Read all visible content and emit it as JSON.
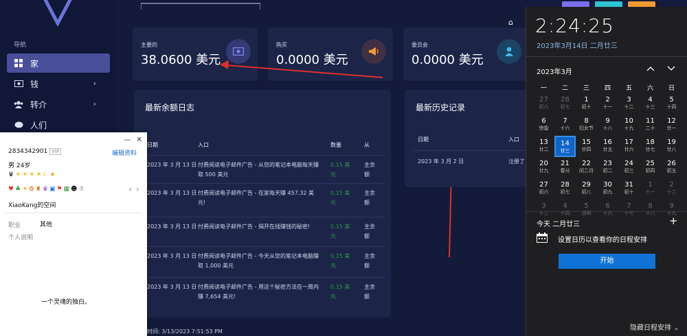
{
  "nav": {
    "title": "导航",
    "items": [
      {
        "label": "家",
        "icon": "grid-icon",
        "active": true
      },
      {
        "label": "钱",
        "icon": "cash-icon"
      },
      {
        "label": "转介",
        "icon": "users-icon"
      },
      {
        "label": "人们",
        "icon": "chat-icon"
      }
    ]
  },
  "stats": [
    {
      "label": "主要的",
      "value": "38.0600 美元",
      "icon": "money-icon",
      "icon_bg": "#343a73",
      "icon_color": "#7f86f2"
    },
    {
      "label": "购买",
      "value": "0.0000 美元",
      "icon": "megaphone-icon",
      "icon_bg": "#3f3044",
      "icon_color": "#f29a33"
    },
    {
      "label": "委员会",
      "value": "0.0000 美元",
      "icon": "user-icon",
      "icon_bg": "#1b4363",
      "icon_color": "#3fb7e8"
    }
  ],
  "balance_log": {
    "title": "最新余额日志",
    "headers": {
      "date": "日期",
      "entry": "入口",
      "amount": "数量",
      "from": "从"
    },
    "rows": [
      {
        "date": "2023 年 3 月 13 日",
        "entry": "付费阅读电子邮件广告 - 从您的笔记本电脑每天赚取 500 美元",
        "amount": "0.15 美元",
        "from": "主余额"
      },
      {
        "date": "2023 年 3 月 13 日",
        "entry": "付费阅读电子邮件广告 - 在家每天赚 457.32 美元!",
        "amount": "0.15 美元",
        "from": "主余额"
      },
      {
        "date": "2023 年 3 月 13 日",
        "entry": "付费阅读电子邮件广告 - 揭开在线赚钱的秘密!",
        "amount": "0.15 美元",
        "from": "主余额"
      },
      {
        "date": "2023 年 3 月 13 日",
        "entry": "付费阅读电子邮件广告 - 今天从您的笔记本电脑赚取 1,000 美元",
        "amount": "0.15 美元",
        "from": "主余额"
      },
      {
        "date": "2023 年 3 月 13 日",
        "entry": "付费阅读电子邮件广告 - 用这个秘密方法在一周内赚 7,654 美元!",
        "amount": "0.15 美元",
        "from": "主余额"
      }
    ]
  },
  "history": {
    "title": "最新历史记录",
    "headers": {
      "date": "日期",
      "entry": "入口"
    },
    "rows": [
      {
        "date": "2023 年 3 月 2 日",
        "entry": "注册了"
      }
    ]
  },
  "footer": {
    "time": "时间: 3/13/2023 7:51:53 PM"
  },
  "profile": {
    "qq": "2834342901",
    "badge": "VIP",
    "edit": "编辑资料",
    "gender_age": "男  24岁",
    "space": "XiaoKang的空间",
    "job_label": "职业",
    "job_value": "其他",
    "bio_label": "个人说明",
    "signature": "一个灵魂的独白。",
    "controls": {
      "minimize": "—",
      "close": "✕",
      "prev": "‹",
      "next": "›"
    }
  },
  "calendar": {
    "time": "2:24:25",
    "date": "2023年3月14日 二月廿三",
    "month": "2023年3月",
    "weekdays": [
      "一",
      "二",
      "三",
      "四",
      "五",
      "六",
      "日"
    ],
    "weeks": [
      [
        {
          "n": "27",
          "s": "初六",
          "dim": true
        },
        {
          "n": "28",
          "s": "初七",
          "dim": true
        },
        {
          "n": "1",
          "s": "初十"
        },
        {
          "n": "2",
          "s": "十一"
        },
        {
          "n": "3",
          "s": "十二"
        },
        {
          "n": "4",
          "s": "十三"
        },
        {
          "n": "5",
          "s": "十四"
        }
      ],
      [
        {
          "n": "6",
          "s": "惊蛰"
        },
        {
          "n": "7",
          "s": "十六"
        },
        {
          "n": "8",
          "s": "妇女节"
        },
        {
          "n": "9",
          "s": "十八"
        },
        {
          "n": "10",
          "s": "十九"
        },
        {
          "n": "11",
          "s": "二十"
        },
        {
          "n": "12",
          "s": "廿一"
        }
      ],
      [
        {
          "n": "13",
          "s": "廿二"
        },
        {
          "n": "14",
          "s": "廿三",
          "today": true
        },
        {
          "n": "15",
          "s": "廿四"
        },
        {
          "n": "16",
          "s": "廿五"
        },
        {
          "n": "17",
          "s": "廿六"
        },
        {
          "n": "18",
          "s": "廿七"
        },
        {
          "n": "19",
          "s": "廿八"
        }
      ],
      [
        {
          "n": "20",
          "s": "廿九"
        },
        {
          "n": "21",
          "s": "春分"
        },
        {
          "n": "22",
          "s": "闰二月"
        },
        {
          "n": "23",
          "s": "初二"
        },
        {
          "n": "24",
          "s": "初三"
        },
        {
          "n": "25",
          "s": "初四"
        },
        {
          "n": "26",
          "s": "初五"
        }
      ],
      [
        {
          "n": "27",
          "s": "初六"
        },
        {
          "n": "28",
          "s": "初七"
        },
        {
          "n": "29",
          "s": "初八"
        },
        {
          "n": "30",
          "s": "初九"
        },
        {
          "n": "31",
          "s": "初十"
        },
        {
          "n": "1",
          "s": "十一",
          "dim": true
        },
        {
          "n": "2",
          "s": "十二",
          "dim": true
        }
      ],
      [
        {
          "n": "3",
          "s": "十三",
          "dim": true
        },
        {
          "n": "4",
          "s": "十四",
          "dim": true
        },
        {
          "n": "5",
          "s": "清明",
          "dim": true
        },
        {
          "n": "6",
          "s": "十六",
          "dim": true
        },
        {
          "n": "7",
          "s": "十七",
          "dim": true
        },
        {
          "n": "8",
          "s": "十八",
          "dim": true
        },
        {
          "n": "9",
          "s": "十九",
          "dim": true
        }
      ]
    ],
    "agenda_title": "今天 二月廿三",
    "agenda_text": "设置日历以查看你的日程安排",
    "start": "开始",
    "hide": "隐藏日程安排",
    "prev_icon": "chevron-up-icon",
    "next_icon": "chevron-down-icon"
  }
}
